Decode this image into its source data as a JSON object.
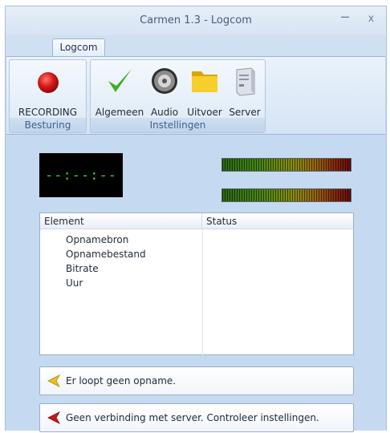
{
  "window": {
    "title": "Carmen 1.3 - Logcom",
    "minimize_glyph": "–",
    "close_glyph": "x"
  },
  "tabs": [
    {
      "label": "Logcom",
      "active": true
    }
  ],
  "ribbon": {
    "groups": [
      {
        "label": "Besturing",
        "buttons": [
          {
            "label": "RECORDING",
            "icon": "record-dot-icon",
            "color": "#d8161a"
          }
        ]
      },
      {
        "label": "Instellingen",
        "buttons": [
          {
            "label": "Algemeen",
            "icon": "checkmark-icon",
            "color": "#3fb020"
          },
          {
            "label": "Audio",
            "icon": "speaker-icon",
            "color": "#4a4a4a"
          },
          {
            "label": "Uitvoer",
            "icon": "folder-icon",
            "color": "#f2c000"
          },
          {
            "label": "Server",
            "icon": "server-icon",
            "color": "#c9cfd6"
          }
        ]
      }
    ]
  },
  "display": {
    "time": "--:--:--",
    "time_color": "#22e32a"
  },
  "level_meters": [
    {
      "name": "left-level-meter"
    },
    {
      "name": "right-level-meter"
    }
  ],
  "grid": {
    "columns": [
      "Element",
      "Status"
    ],
    "rows": [
      {
        "element": "Opnamebron",
        "status": ""
      },
      {
        "element": "Opnamebestand",
        "status": ""
      },
      {
        "element": "Bitrate",
        "status": ""
      },
      {
        "element": "Uur",
        "status": ""
      }
    ]
  },
  "messages": [
    {
      "text": "Er loopt geen opname.",
      "icon": "yellow-flag-icon",
      "color": "#e8c21a"
    },
    {
      "text": "Geen verbinding met server. Controleer instellingen.",
      "icon": "red-flag-icon",
      "color": "#c8161a"
    }
  ]
}
